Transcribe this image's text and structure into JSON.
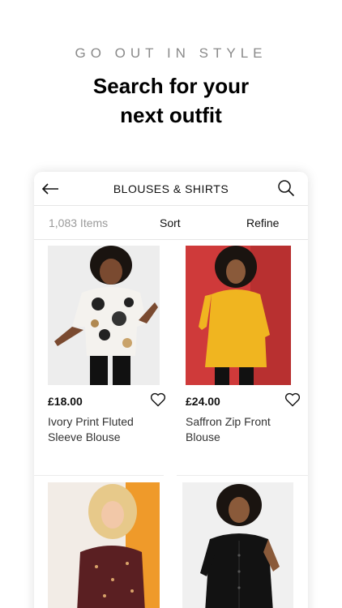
{
  "promo": {
    "tagline": "GO OUT IN STYLE",
    "headline_line1": "Search for your",
    "headline_line2": "next outfit"
  },
  "app": {
    "title": "BLOUSES & SHIRTS",
    "back_icon": "arrow-left-icon",
    "search_icon": "search-icon"
  },
  "filters": {
    "count": "1,083 Items",
    "sort": "Sort",
    "refine": "Refine"
  },
  "products": [
    {
      "price": "£18.00",
      "name": "Ivory Print Fluted Sleeve Blouse"
    },
    {
      "price": "£24.00",
      "name": "Saffron Zip Front Blouse"
    },
    {
      "price": "",
      "name": ""
    },
    {
      "price": "",
      "name": ""
    }
  ]
}
